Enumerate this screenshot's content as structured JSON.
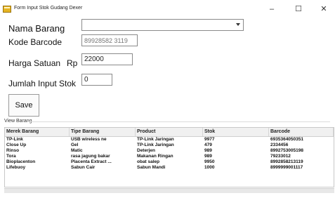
{
  "window": {
    "title": "Form Input Stok Gudang Dexer",
    "minimize": "–",
    "maximize": "☐",
    "close": "✕"
  },
  "form": {
    "nama_barang_label": "Nama Barang",
    "nama_barang_value": "",
    "kode_barcode_label": "Kode Barcode",
    "kode_barcode_value": "89928582 3119",
    "harga_label": "Harga Satuan",
    "harga_prefix": "Rp",
    "harga_value": "22000",
    "jumlah_label": "Jumlah Input Stok",
    "jumlah_value": "0",
    "save_label": "Save"
  },
  "grid": {
    "section_label": "View Barang",
    "columns": [
      "Merek Barang",
      "Tipe Barang",
      "Product",
      "Stok",
      "Barcode"
    ],
    "rows": [
      [
        "TP-Link",
        "USB wireless ne",
        "TP-Link Jaringan",
        "9977",
        "6935364050351"
      ],
      [
        "Close Up",
        "Gel",
        "TP-Link Jaringan",
        "479",
        "2334456"
      ],
      [
        "Rinso",
        "Matic",
        "Deterjen",
        "989",
        "8992753005198"
      ],
      [
        "Tora",
        "rasa jagung bakar",
        "Makanan Ringan",
        "989",
        "79233012"
      ],
      [
        "Bioplacenton",
        "Placenta Extract ...",
        "obat salep",
        "9950",
        "8992858213119"
      ],
      [
        "Lifebuoy",
        "Sabun Cair",
        "Sabun Mandi",
        "1000",
        "8999999001117"
      ]
    ]
  },
  "colors": {
    "border": "#8a8a8a",
    "header_bg": "#f0f0f0",
    "icon_yellow": "#e6b422"
  }
}
